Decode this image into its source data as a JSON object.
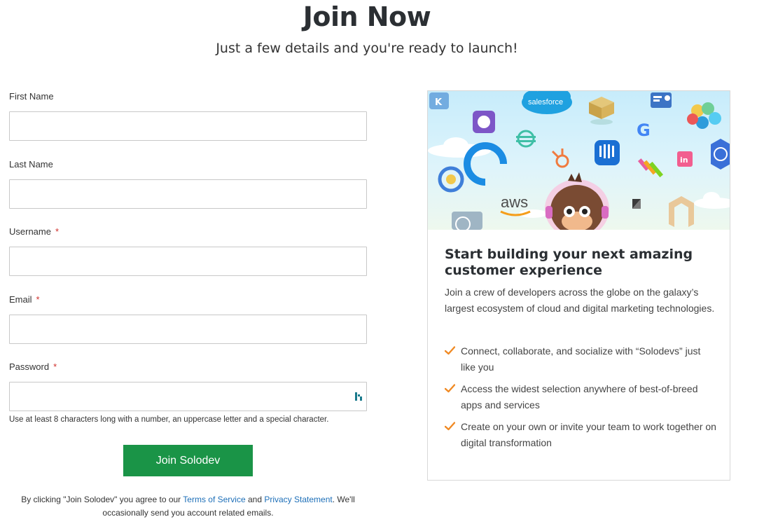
{
  "header": {
    "title": "Join Now",
    "subtitle": "Just a few details and you're ready to launch!"
  },
  "form": {
    "first_name_label": "First Name",
    "last_name_label": "Last Name",
    "username_label": "Username",
    "email_label": "Email",
    "password_label": "Password",
    "required_marker": "*",
    "first_name_value": "",
    "last_name_value": "",
    "username_value": "",
    "email_value": "",
    "password_value": "",
    "password_hint": "Use at least 8 characters long with a number, an uppercase letter and a special character.",
    "submit_label": "Join Solodev",
    "legal_prefix": "By clicking \"Join Solodev\" you agree to our ",
    "terms_link": "Terms of Service",
    "legal_and": " and ",
    "privacy_link": "Privacy Statement",
    "legal_suffix": ". We'll occasionally send you account related emails."
  },
  "card": {
    "banner_labels": {
      "salesforce": "salesforce",
      "aws": "aws"
    },
    "title": "Start building your next amazing customer experience",
    "description": "Join a crew of developers across the globe on the galaxy’s largest ecosystem of cloud and digital marketing technologies.",
    "bullets": [
      "Connect, collaborate, and socialize with “Solodevs” just like you",
      "Access the widest selection anywhere of best-of-breed apps and services",
      "Create on your own or invite your team to work together on digital transformation"
    ]
  },
  "colors": {
    "primary_button": "#1a9447",
    "link": "#1d6fb8",
    "required": "#d0312d",
    "check": "#f08a24"
  },
  "icons": [
    "password-manager-icon",
    "check-icon",
    "salesforce-logo",
    "aws-logo",
    "monkey-mascot"
  ]
}
